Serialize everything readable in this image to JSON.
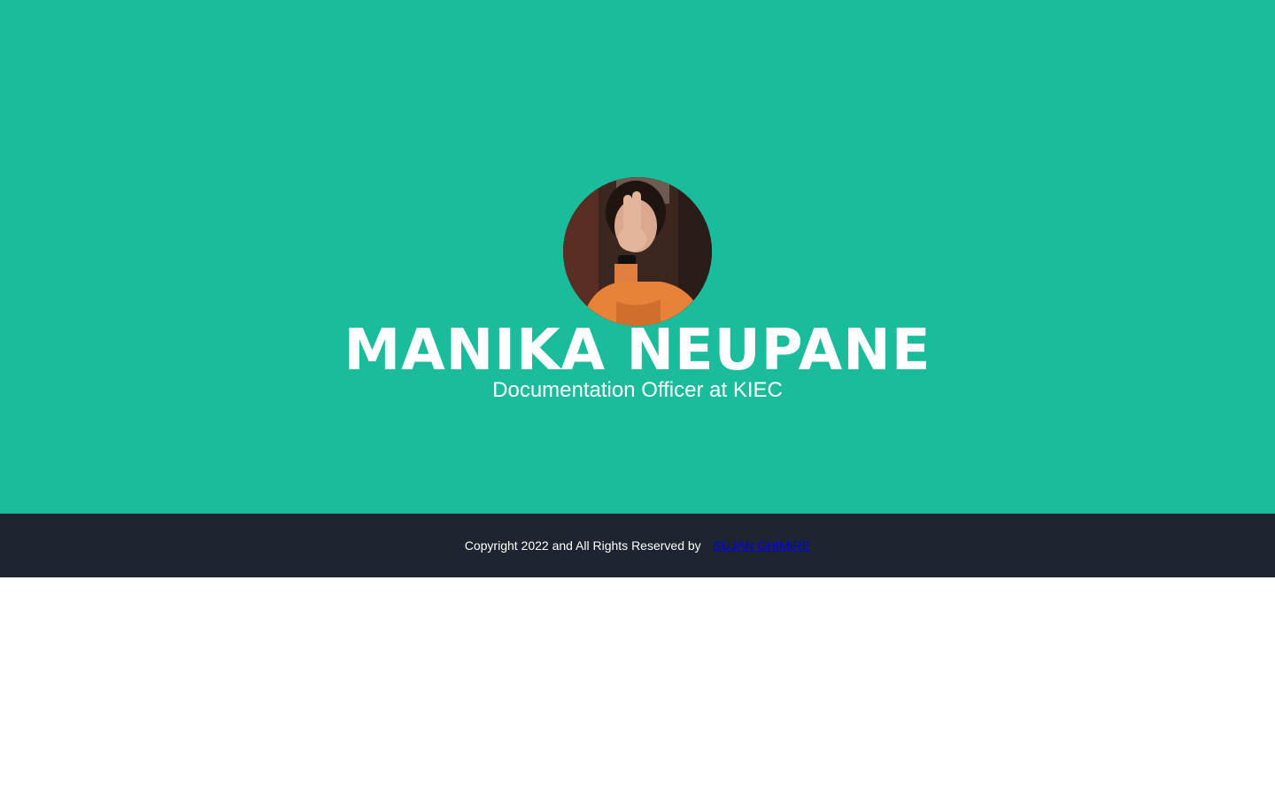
{
  "profile": {
    "name": "MANIKA NEUPANE",
    "title": "Documentation Officer at KIEC"
  },
  "social": {
    "link1_icon": "facebook-icon",
    "link1_glyph": "",
    "link2_icon": "instagram-icon",
    "link2_glyph": ""
  },
  "footer": {
    "copyright": "Copyright 2022 and All Rights Reserved by",
    "author_link": "SUJAN GHIMIRE"
  },
  "colors": {
    "hero_bg": "#1abc9c",
    "footer_bg": "#1e2530",
    "link": "#0000ee"
  }
}
